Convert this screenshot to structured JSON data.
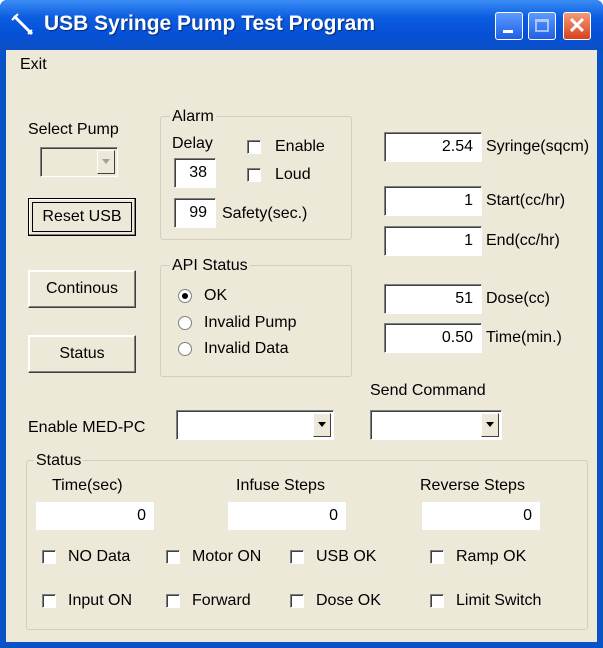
{
  "window": {
    "title": "USB Syringe Pump Test Program"
  },
  "menu": {
    "exit": "Exit"
  },
  "select_pump": {
    "label": "Select Pump",
    "value": ""
  },
  "buttons": {
    "reset_usb": "Reset USB",
    "continous": "Continous",
    "status": "Status"
  },
  "alarm": {
    "group_title": "Alarm",
    "delay_label": "Delay",
    "delay_value": "38",
    "enable_label": "Enable",
    "loud_label": "Loud",
    "safety_value": "99",
    "safety_label": "Safety(sec.)"
  },
  "api_status": {
    "group_title": "API Status",
    "options": [
      "OK",
      "Invalid Pump",
      "Invalid Data"
    ],
    "selected": "OK"
  },
  "params": {
    "syringe_value": "2.54",
    "syringe_label": "Syringe(sqcm)",
    "start_value": "1",
    "start_label": "Start(cc/hr)",
    "end_value": "1",
    "end_label": "End(cc/hr)",
    "dose_value": "51",
    "dose_label": "Dose(cc)",
    "time_value": "0.50",
    "time_label": "Time(min.)"
  },
  "send_command": {
    "label": "Send Command",
    "value": ""
  },
  "enable_medpc": {
    "label": "Enable MED-PC",
    "value": ""
  },
  "status_group": {
    "title": "Status",
    "time_label": "Time(sec)",
    "time_value": "0",
    "infuse_label": "Infuse Steps",
    "infuse_value": "0",
    "reverse_label": "Reverse Steps",
    "reverse_value": "0",
    "checks": {
      "no_data": "NO Data",
      "motor_on": "Motor ON",
      "usb_ok": "USB OK",
      "ramp_ok": "Ramp OK",
      "input_on": "Input ON",
      "forward": "Forward",
      "dose_ok": "Dose OK",
      "limit_switch": "Limit Switch"
    }
  },
  "colors": {
    "titlebar": "#0650d6",
    "client": "#ece9d8",
    "close": "#d9421d"
  }
}
